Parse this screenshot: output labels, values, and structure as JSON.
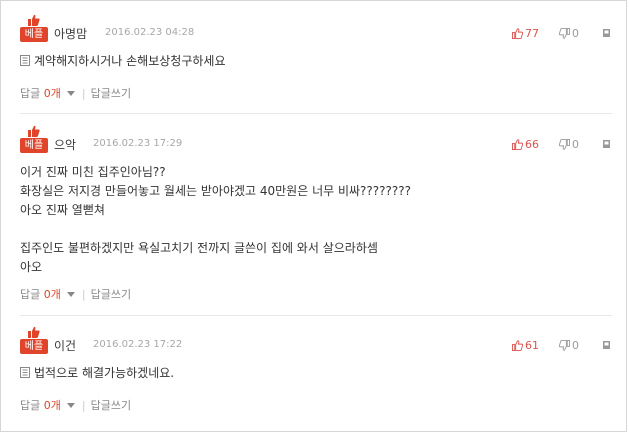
{
  "best_label": "베플",
  "reply_label": "답글",
  "reply_write_label": "답글쓰기",
  "comments": [
    {
      "user": "아명맘",
      "date": "2016.02.23 04:28",
      "up": "77",
      "down": "0",
      "lines": [
        "계약해지하시거나 손해보상청구하세요"
      ],
      "reply_count": "0개"
    },
    {
      "user": "으악",
      "date": "2016.02.23 17:29",
      "up": "66",
      "down": "0",
      "lines": [
        "이거 진짜 미친 집주인아님??",
        "화장실은 저지경 만들어놓고 월세는 받아야겠고 40만원은 너무 비싸????????",
        "아오 진짜 열뻗쳐",
        "",
        "집주인도 불편하겠지만 욕실고치기 전까지 글쓴이 집에 와서 살으라하셈",
        "아오"
      ],
      "reply_count": "0개"
    },
    {
      "user": "이건",
      "date": "2016.02.23 17:22",
      "up": "61",
      "down": "0",
      "lines": [
        "법적으로 해결가능하겠네요."
      ],
      "reply_count": "0개"
    }
  ]
}
